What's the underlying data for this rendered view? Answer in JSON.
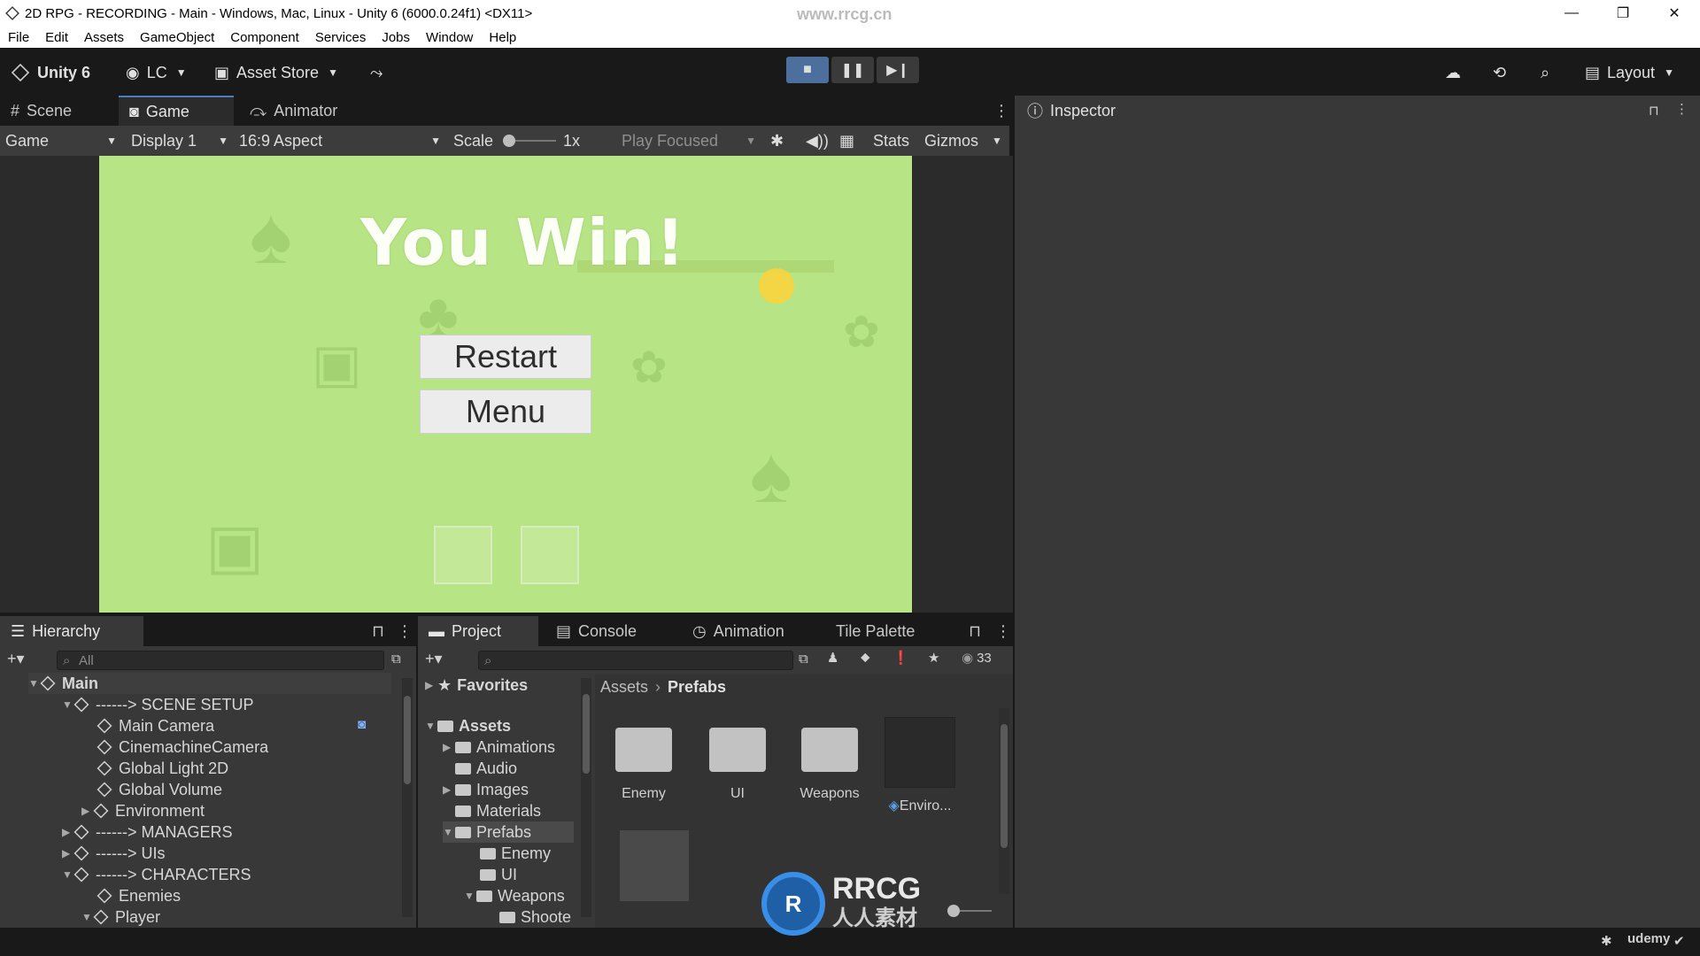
{
  "window": {
    "title": "2D RPG - RECORDING - Main - Windows, Mac, Linux - Unity 6 (6000.0.24f1) <DX11>",
    "watermark": "www.rrcg.cn",
    "minimize": "—",
    "restore": "❐",
    "close": "✕"
  },
  "menu": [
    "File",
    "Edit",
    "Assets",
    "GameObject",
    "Component",
    "Services",
    "Jobs",
    "Window",
    "Help"
  ],
  "toolbar": {
    "unity_label": "Unity 6",
    "account_label": "LC",
    "asset_store_label": "Asset Store",
    "layout_label": "Layout"
  },
  "game_panel": {
    "tabs": [
      "Scene",
      "Game",
      "Animator"
    ],
    "active_tab": "Game",
    "view_mode": "Game",
    "display": "Display 1",
    "aspect": "16:9 Aspect",
    "scale_label": "Scale",
    "scale_value": "1x",
    "play_mode": "Play Focused",
    "stats_label": "Stats",
    "gizmos_label": "Gizmos",
    "win_text": "You Win!",
    "restart_label": "Restart",
    "menu_label": "Menu"
  },
  "inspector": {
    "tab_label": "Inspector"
  },
  "hierarchy": {
    "tab_label": "Hierarchy",
    "search_placeholder": "All",
    "root": "Main",
    "rows": [
      {
        "label": "------> SCENE SETUP",
        "indent": 1,
        "expanded": true
      },
      {
        "label": "Main Camera",
        "indent": 2
      },
      {
        "label": "CinemachineCamera",
        "indent": 2
      },
      {
        "label": "Global Light 2D",
        "indent": 2
      },
      {
        "label": "Global Volume",
        "indent": 2
      },
      {
        "label": "Environment",
        "indent": 2,
        "collapsed": true
      },
      {
        "label": "------> MANAGERS",
        "indent": 1,
        "collapsed": true
      },
      {
        "label": "------> UIs",
        "indent": 1,
        "collapsed": true
      },
      {
        "label": "------> CHARACTERS",
        "indent": 1,
        "expanded": true
      },
      {
        "label": "Enemies",
        "indent": 2
      },
      {
        "label": "Player",
        "indent": 2,
        "expanded": true
      }
    ]
  },
  "project": {
    "tabs": [
      "Project",
      "Console",
      "Animation",
      "Tile Palette"
    ],
    "visible_count": "33",
    "favorites_label": "Favorites",
    "tree": [
      {
        "label": "Assets",
        "indent": 0,
        "expanded": true
      },
      {
        "label": "Animations",
        "indent": 1,
        "collapsed": true
      },
      {
        "label": "Audio",
        "indent": 1
      },
      {
        "label": "Images",
        "indent": 1,
        "collapsed": true
      },
      {
        "label": "Materials",
        "indent": 1
      },
      {
        "label": "Prefabs",
        "indent": 1,
        "expanded": true,
        "selected": true
      },
      {
        "label": "Enemy",
        "indent": 2
      },
      {
        "label": "UI",
        "indent": 2
      },
      {
        "label": "Weapons",
        "indent": 2,
        "expanded": true
      },
      {
        "label": "Shoote",
        "indent": 3
      }
    ],
    "breadcrumb": [
      "Assets",
      "Prefabs"
    ],
    "items": [
      {
        "label": "Enemy",
        "kind": "folder"
      },
      {
        "label": "UI",
        "kind": "folder"
      },
      {
        "label": "Weapons",
        "kind": "folder"
      },
      {
        "label": "Enviro...",
        "kind": "prefab"
      }
    ]
  },
  "overlay_logo": {
    "main": "RRCG",
    "sub": "人人素材"
  },
  "status": {
    "udemy": "udemy"
  },
  "colors": {
    "accent": "#4c7fc1",
    "game_background": "#b7e484",
    "panel": "#383838"
  }
}
